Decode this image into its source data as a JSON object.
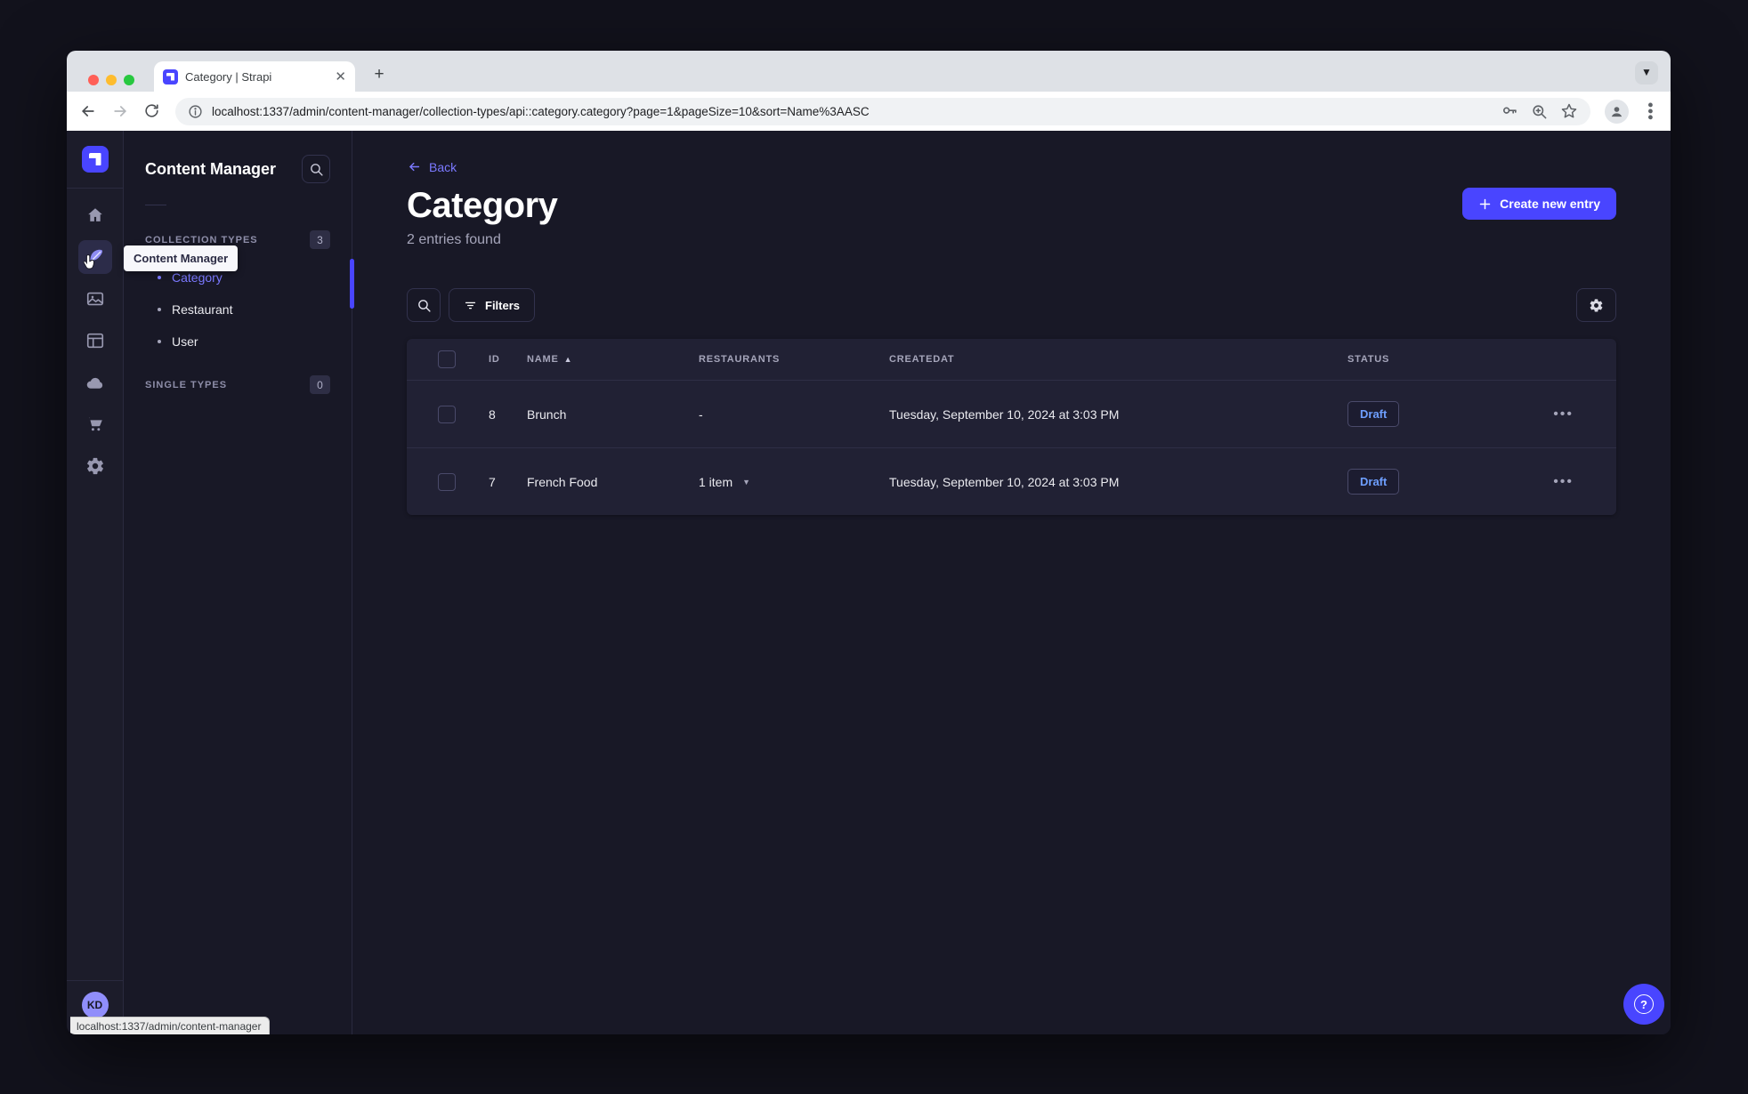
{
  "browser": {
    "tab_title": "Category | Strapi",
    "url": "localhost:1337/admin/content-manager/collection-types/api::category.category?page=1&pageSize=10&sort=Name%3AASC",
    "status_link": "localhost:1337/admin/content-manager",
    "traffic_colors": {
      "close": "#ff5f57",
      "minimize": "#febc2e",
      "maximize": "#28c840"
    }
  },
  "sidebar": {
    "tooltip": "Content Manager",
    "avatar_initials": "KD",
    "items": [
      {
        "icon": "home-icon"
      },
      {
        "icon": "content-manager-feather-icon",
        "active": true
      },
      {
        "icon": "media-library-icon"
      },
      {
        "icon": "content-type-builder-icon"
      },
      {
        "icon": "cloud-icon"
      },
      {
        "icon": "marketplace-cart-icon"
      },
      {
        "icon": "settings-gear-icon"
      }
    ]
  },
  "subnav": {
    "title": "Content Manager",
    "sections": [
      {
        "label": "COLLECTION TYPES",
        "badge": "3"
      },
      {
        "label": "SINGLE TYPES",
        "badge": "0"
      }
    ],
    "items": [
      {
        "label": "Category",
        "active": true
      },
      {
        "label": "Restaurant"
      },
      {
        "label": "User"
      }
    ]
  },
  "page": {
    "back_label": "Back",
    "title": "Category",
    "subtitle": "2 entries found",
    "create_button": "Create new entry",
    "filters_button": "Filters"
  },
  "table": {
    "headers": {
      "id": "ID",
      "name": "NAME",
      "restaurants": "RESTAURANTS",
      "createdat": "CREATEDAT",
      "status": "STATUS"
    },
    "sort": {
      "column": "NAME",
      "direction": "ascending"
    },
    "rows": [
      {
        "id": "8",
        "name": "Brunch",
        "restaurants": "-",
        "created_at": "Tuesday, September 10, 2024 at 3:03 PM",
        "status": "Draft"
      },
      {
        "id": "7",
        "name": "French Food",
        "restaurants": "1 item",
        "created_at": "Tuesday, September 10, 2024 at 3:03 PM",
        "status": "Draft"
      }
    ]
  },
  "colors": {
    "primary": "#4945ff",
    "active_link": "#7b79ff",
    "draft_text": "#6e9fff",
    "app_bg": "#181826",
    "card_bg": "#212134"
  }
}
